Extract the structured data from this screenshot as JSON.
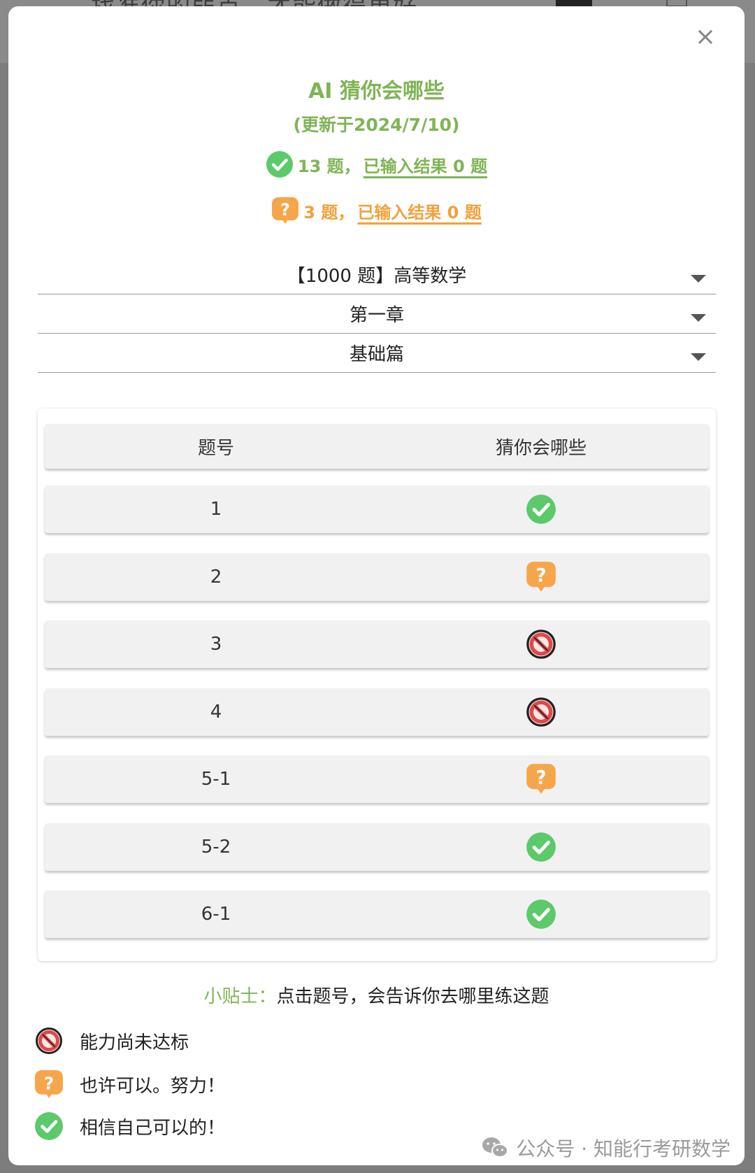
{
  "backdrop": {
    "text": "找准你的弱点，才能做得更好"
  },
  "dialog": {
    "close_label": "×",
    "title": "AI 猜你会哪些",
    "subtitle": "(更新于2024/7/10)",
    "stats": {
      "green": {
        "count": "13 题，",
        "link": "已输入结果 0 题",
        "icon": "check-circle-icon"
      },
      "orange": {
        "count": "3 题，",
        "link": "已输入结果 0 题",
        "icon": "question-bubble-icon"
      }
    },
    "selects": {
      "book": "【1000 题】高等数学",
      "chapter": "第一章",
      "section": "基础篇"
    },
    "table": {
      "headers": [
        "题号",
        "猜你会哪些"
      ],
      "rows": [
        {
          "id": "1",
          "status": "check"
        },
        {
          "id": "2",
          "status": "question"
        },
        {
          "id": "3",
          "status": "no"
        },
        {
          "id": "4",
          "status": "no"
        },
        {
          "id": "5-1",
          "status": "question"
        },
        {
          "id": "5-2",
          "status": "check"
        },
        {
          "id": "6-1",
          "status": "check"
        }
      ]
    },
    "tip": {
      "label": "小贴士：",
      "text": "点击题号，会告诉你去哪里练这题"
    },
    "legend": {
      "no": "能力尚未达标",
      "question": "也许可以。努力！",
      "check": "相信自己可以的！"
    },
    "watermark": "公众号 · 知能行考研数学",
    "colors": {
      "green": "#5cc96a",
      "orange": "#f6a64a",
      "red": "#e04848",
      "accent_text": "#7fb455"
    }
  }
}
